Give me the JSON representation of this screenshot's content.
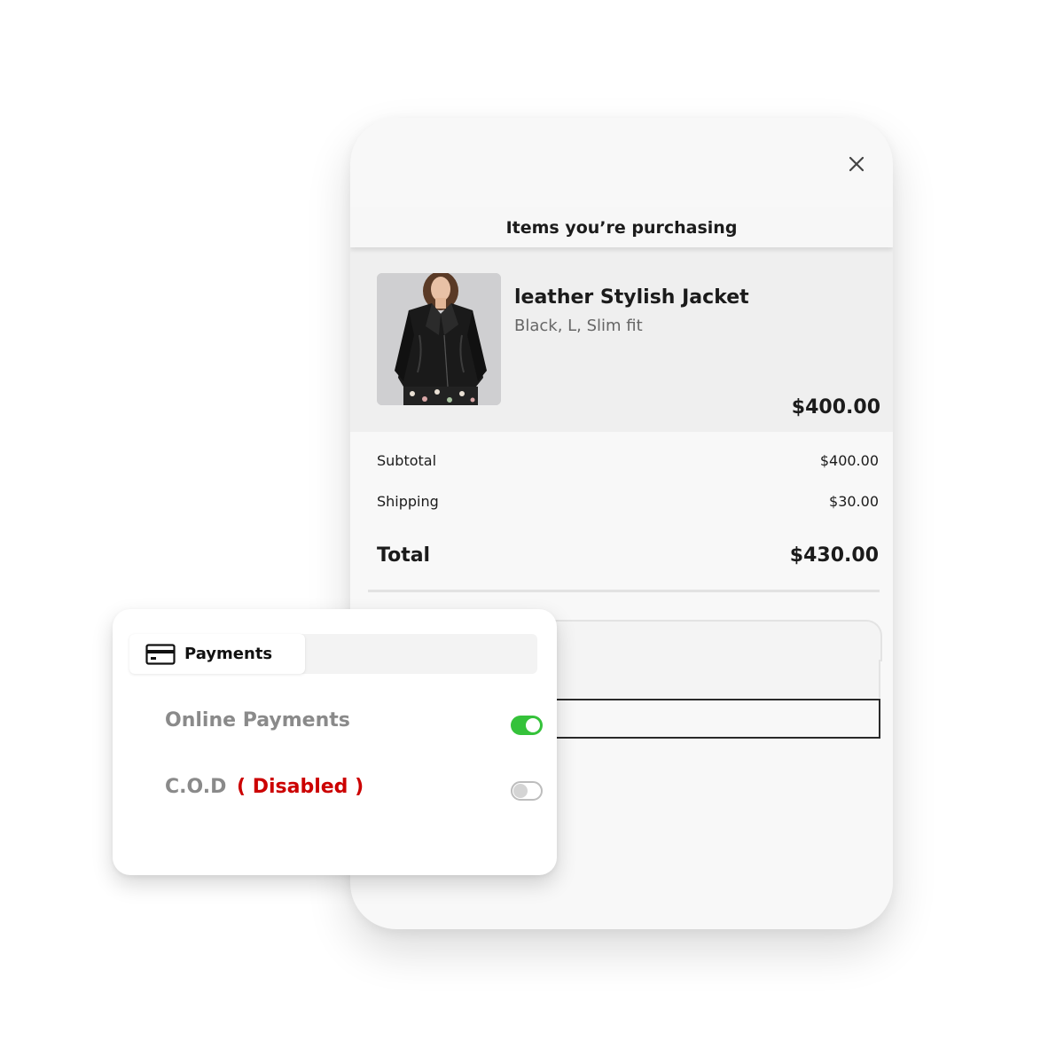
{
  "checkout": {
    "header_title": "Items you’re purchasing",
    "product": {
      "name": "leather Stylish Jacket",
      "variant": "Black, L, Slim fit",
      "price": "$400.00"
    },
    "summary": {
      "subtotal_label": "Subtotal",
      "subtotal_value": "$400.00",
      "shipping_label": "Shipping",
      "shipping_value": "$30.00",
      "total_label": "Total",
      "total_value": "$430.00"
    }
  },
  "payments": {
    "tab_label": "Payments",
    "tab_icon": "credit-card-icon",
    "options": [
      {
        "label": "Online Payments",
        "suffix": "",
        "enabled": true
      },
      {
        "label": "C.O.D",
        "suffix": "( Disabled )",
        "enabled": false
      }
    ]
  },
  "colors": {
    "toggle_on": "#35c23a",
    "disabled_text": "#cc0000"
  }
}
